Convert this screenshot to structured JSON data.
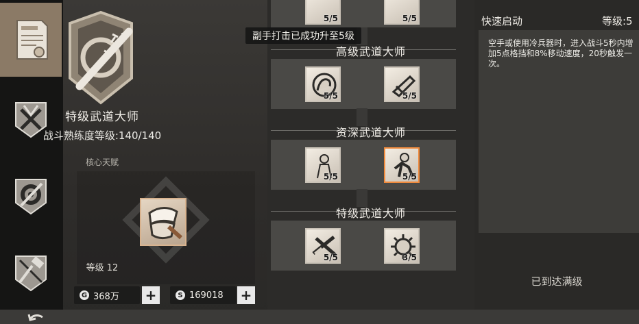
{
  "sidebar": {
    "tabs": [
      {
        "icon": "certificate-icon",
        "active": true
      },
      {
        "icon": "combat-emblem-icon",
        "active": false
      },
      {
        "icon": "gear-wrench-icon",
        "active": false
      },
      {
        "icon": "blueprint-hammer-icon",
        "active": false
      }
    ]
  },
  "detail": {
    "emblem_icon": "spiked-bat-emblem-icon",
    "title": "特级武道大师",
    "proficiency": "战斗熟练度等级:140/140",
    "core_label": "核心天赋",
    "core_skill_icon": "wrapped-fist-icon",
    "core_level": "等级 12",
    "currency": [
      {
        "icon": "G",
        "value": "368万",
        "plus": "+"
      },
      {
        "icon": "S",
        "value": "169018",
        "plus": "+"
      }
    ]
  },
  "toast": "副手打击已成功升至5级",
  "tree": {
    "tiers": [
      {
        "name": "",
        "skills": [
          {
            "count": "5/5",
            "icon": "fist-icon"
          },
          {
            "count": "5/5",
            "icon": "blade-icon"
          }
        ]
      },
      {
        "name": "高级武道大师",
        "skills": [
          {
            "count": "5/5",
            "icon": "flexed-arm-icon",
            "selected": false
          },
          {
            "count": "5/5",
            "icon": "blade-hand-icon",
            "selected": false
          }
        ]
      },
      {
        "name": "资深武道大师",
        "skills": [
          {
            "count": "5/5",
            "icon": "fighter-icon",
            "selected": false
          },
          {
            "count": "5/5",
            "icon": "runner-icon",
            "selected": true
          }
        ]
      },
      {
        "name": "特级武道大师",
        "skills": [
          {
            "count": "5/5",
            "icon": "crossed-blades-icon",
            "selected": false
          },
          {
            "count": "3/5",
            "icon": "spiked-ball-icon",
            "selected": false
          }
        ]
      }
    ]
  },
  "right": {
    "skill_name": "快速启动",
    "skill_level": "等级:5",
    "description": "空手或使用冷兵器时，进入战斗5秒内增加5点格挡和8%移动速度，20秒触发一次。",
    "status": "已到达满级"
  },
  "colors": {
    "accent_orange": "#f08a3c",
    "active_tab": "#8b7a66"
  }
}
